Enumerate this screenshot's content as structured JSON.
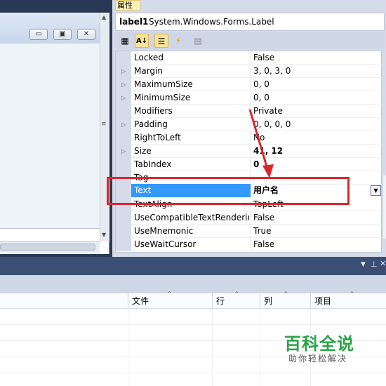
{
  "properties_panel": {
    "tab_label": "属性",
    "object_name": "label1",
    "object_type": "System.Windows.Forms.Label",
    "toolbar": {
      "categorized_icon": "categorized-icon",
      "alphabetical_icon": "alphabetical-icon",
      "properties_icon": "properties-icon",
      "events_icon": "events-icon",
      "property_pages_icon": "property-pages-icon"
    },
    "rows": [
      {
        "name": "Locked",
        "value": "False"
      },
      {
        "name": "Margin",
        "value": "3, 0, 3, 0"
      },
      {
        "name": "MaximumSize",
        "value": "0, 0"
      },
      {
        "name": "MinimumSize",
        "value": "0, 0"
      },
      {
        "name": "Modifiers",
        "value": "Private"
      },
      {
        "name": "Padding",
        "value": "0, 0, 0, 0"
      },
      {
        "name": "RightToLeft",
        "value": "No"
      },
      {
        "name": "Size",
        "value": "41, 12"
      },
      {
        "name": "TabIndex",
        "value": "0"
      },
      {
        "name": "Tag",
        "value": ""
      },
      {
        "name": "Text",
        "value": "用户名"
      },
      {
        "name": "TextAlign",
        "value": "TopLeft"
      },
      {
        "name": "UseCompatibleTextRenderin",
        "value": "False"
      },
      {
        "name": "UseMnemonic",
        "value": "True"
      },
      {
        "name": "UseWaitCursor",
        "value": "False"
      }
    ]
  },
  "designer": {
    "minimize_icon": "minimize-icon",
    "maximize_icon": "maximize-icon",
    "close_icon": "close-icon"
  },
  "error_list": {
    "columns": [
      "文件",
      "行",
      "列",
      "项目"
    ]
  },
  "watermark": {
    "title": "百科全说",
    "subtitle": "助你轻松解决"
  },
  "colors": {
    "selection": "#3399ff",
    "highlight_box": "#d9272e",
    "watermark_green": "#2aa345"
  }
}
